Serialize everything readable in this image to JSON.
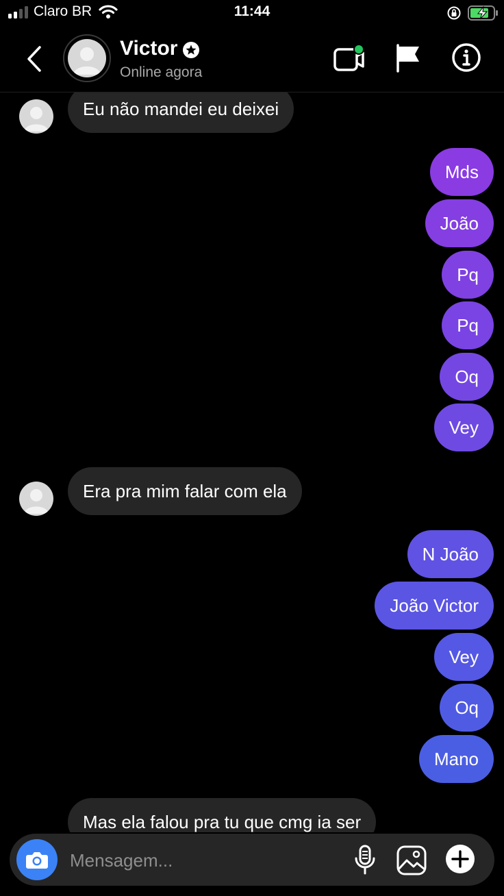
{
  "status_bar": {
    "carrier": "Claro BR",
    "time": "11:44",
    "signal_bars": 4,
    "signal_active": 2,
    "battery": "charging"
  },
  "header": {
    "contact_name": "Victor",
    "contact_status": "Online agora",
    "icons": [
      "back-icon",
      "video-call-icon",
      "flag-icon",
      "info-icon"
    ],
    "online_dot_color": "#22c55e"
  },
  "messages": [
    {
      "side": "in",
      "text": "Eu não mandei eu deixei"
    },
    {
      "side": "out",
      "text": "Mds"
    },
    {
      "side": "out",
      "text": "João"
    },
    {
      "side": "out",
      "text": "Pq"
    },
    {
      "side": "out",
      "text": "Pq"
    },
    {
      "side": "out",
      "text": "Oq"
    },
    {
      "side": "out",
      "text": "Vey"
    },
    {
      "side": "in",
      "text": "Era pra mim falar com ela"
    },
    {
      "side": "out",
      "text": "N João"
    },
    {
      "side": "out",
      "text": "João Victor"
    },
    {
      "side": "out",
      "text": "Vey"
    },
    {
      "side": "out",
      "text": "Oq"
    },
    {
      "side": "out",
      "text": "Mano"
    },
    {
      "side": "in",
      "text": "Mas ela falou pra tu que cmg ia ser"
    }
  ],
  "composer": {
    "placeholder": "Mensagem...",
    "icons": [
      "camera-icon",
      "microphone-icon",
      "gallery-icon",
      "plus-icon"
    ]
  },
  "colors": {
    "background": "#000000",
    "incoming_bubble": "#262626",
    "outgoing_gradient_top": "#8a3be2",
    "outgoing_gradient_bottom": "#4a5ee4",
    "camera_button": "#3b82f6"
  }
}
